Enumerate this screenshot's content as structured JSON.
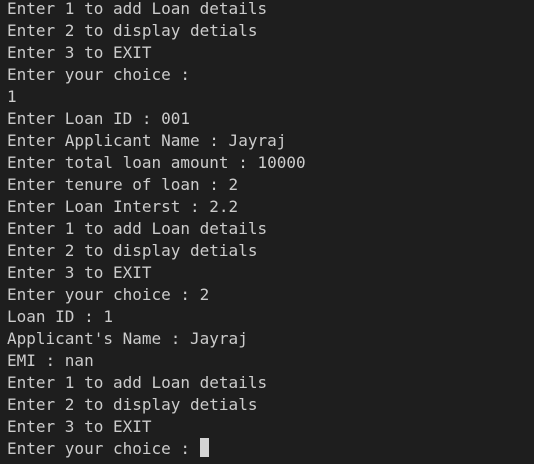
{
  "terminal": {
    "lines": [
      "Enter 1 to add Loan details",
      "Enter 2 to display detials",
      "Enter 3 to EXIT",
      "Enter your choice :",
      "1",
      "Enter Loan ID : 001",
      "Enter Applicant Name : Jayraj",
      "Enter total loan amount : 10000",
      "Enter tenure of loan : 2",
      "Enter Loan Interst : 2.2",
      "Enter 1 to add Loan details",
      "Enter 2 to display detials",
      "Enter 3 to EXIT",
      "Enter your choice : 2",
      "Loan ID : 1",
      "Applicant's Name : Jayraj",
      "EMI : nan",
      "Enter 1 to add Loan details",
      "Enter 2 to display detials",
      "Enter 3 to EXIT"
    ],
    "prompt": "Enter your choice : "
  }
}
